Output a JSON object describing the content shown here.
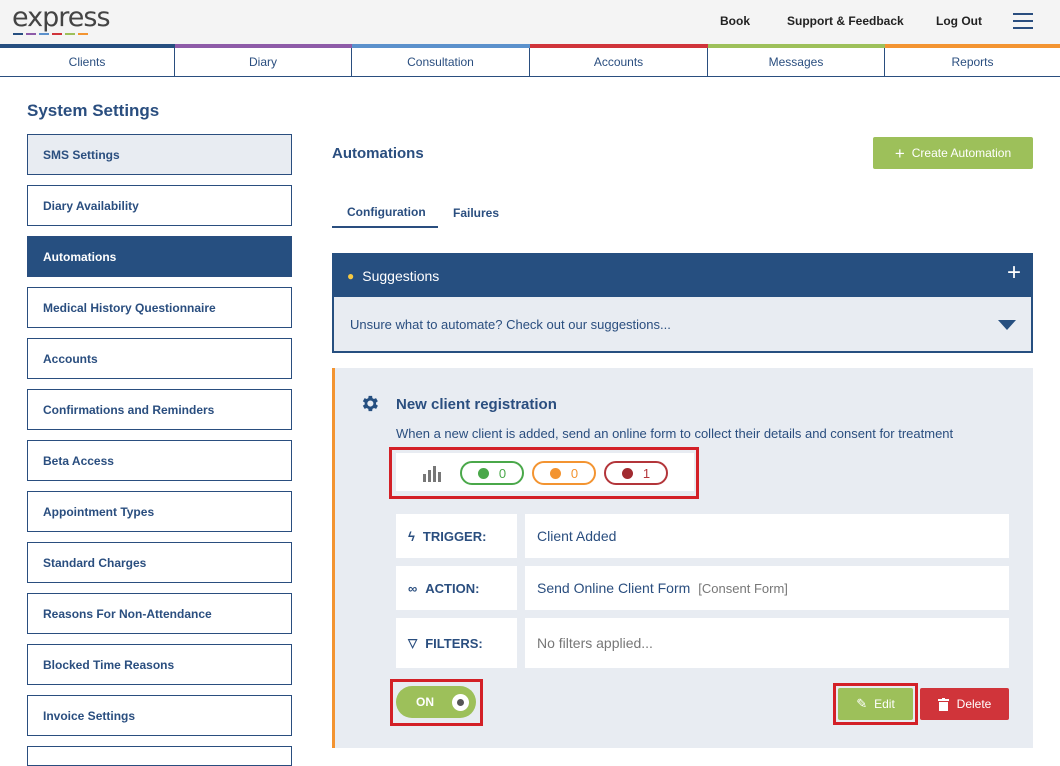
{
  "header": {
    "logo": "express",
    "links": [
      "Book",
      "Support & Feedback",
      "Log Out"
    ],
    "brand_colors": [
      "#264f80",
      "#8e5ba8",
      "#5b91cc",
      "#d0343a",
      "#9dc05a",
      "#f39431"
    ]
  },
  "nav": {
    "tabs": [
      "Clients",
      "Diary",
      "Consultation",
      "Accounts",
      "Messages",
      "Reports"
    ]
  },
  "sidebar": {
    "title": "System Settings",
    "items": [
      "SMS Settings",
      "Diary Availability",
      "Automations",
      "Medical History Questionnaire",
      "Accounts",
      "Confirmations and Reminders",
      "Beta Access",
      "Appointment Types",
      "Standard Charges",
      "Reasons For Non-Attendance",
      "Blocked Time Reasons",
      "Invoice Settings"
    ],
    "active_item": "Automations"
  },
  "main": {
    "title": "Automations",
    "create_button": "Create Automation",
    "tabs": [
      "Configuration",
      "Failures"
    ],
    "active_tab": "Configuration",
    "suggestions": {
      "title": "Suggestions",
      "body": "Unsure what to automate? Check out our suggestions..."
    },
    "automation": {
      "title": "New client registration",
      "description": "When a new client is added, send an online form to collect their details and consent for treatment",
      "stats": {
        "success": "0",
        "warning": "0",
        "failed": "1"
      },
      "trigger": {
        "label": "TRIGGER:",
        "value": "Client Added"
      },
      "action": {
        "label": "ACTION:",
        "value": "Send Online Client Form",
        "detail": "[Consent Form]"
      },
      "filters": {
        "label": "FILTERS:",
        "value": "No filters applied..."
      },
      "toggle": "ON",
      "edit": "Edit",
      "delete": "Delete"
    }
  }
}
